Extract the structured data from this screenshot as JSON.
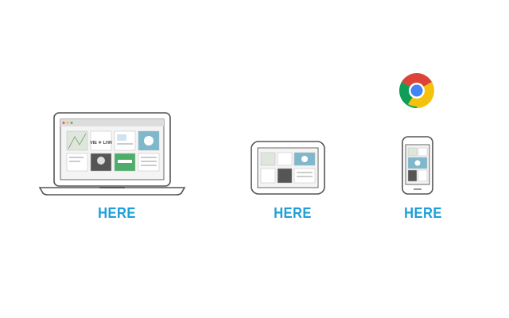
{
  "labels": {
    "laptop": "HERE",
    "tablet": "HERE",
    "phone": "HERE"
  },
  "screen_tiles": {
    "flight": "VIE ✈ LHR"
  },
  "icons": {
    "laptop": "laptop-icon",
    "tablet": "tablet-icon",
    "phone": "phone-icon",
    "browser": "chrome-logo-icon"
  },
  "colors": {
    "accent": "#1e9fd8",
    "outline": "#555555",
    "chrome_red": "#db4437",
    "chrome_yellow": "#f4c20d",
    "chrome_green": "#0f9d58",
    "chrome_blue": "#4285f4"
  }
}
